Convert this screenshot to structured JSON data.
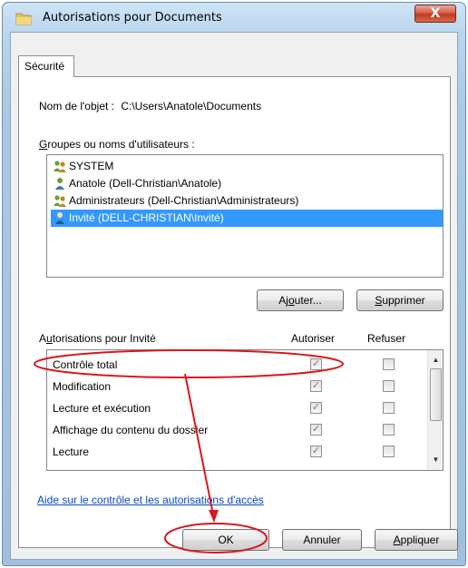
{
  "window": {
    "title": "Autorisations pour Documents",
    "close_label": "X"
  },
  "tab": {
    "label": "Sécurité"
  },
  "object": {
    "label": "Nom de l'objet :",
    "path": "C:\\Users\\Anatole\\Documents"
  },
  "groups": {
    "label_u": "G",
    "label_rest": "roupes ou noms d'utilisateurs :",
    "users": [
      {
        "name": "SYSTEM",
        "icon": "user-group-icon"
      },
      {
        "name": "Anatole (Dell-Christian\\Anatole)",
        "icon": "user-icon"
      },
      {
        "name": "Administrateurs (Dell-Christian\\Administrateurs)",
        "icon": "user-group-icon"
      },
      {
        "name": "Invité (DELL-CHRISTIAN\\Invité)",
        "icon": "user-icon",
        "selected": true
      }
    ]
  },
  "buttons": {
    "add_pre": "Aj",
    "add_u": "o",
    "add_post": "uter...",
    "remove_u": "S",
    "remove_post": "upprimer",
    "ok": "OK",
    "cancel": "Annuler",
    "apply_u": "A",
    "apply_post": "ppliquer"
  },
  "permissions": {
    "header_pre": "A",
    "header_u": "u",
    "header_post": "torisations pour Invité",
    "allow_header": "Autoriser",
    "deny_header": "Refuser",
    "rows": [
      {
        "label": "Contrôle total",
        "allow": true,
        "deny": false
      },
      {
        "label": "Modification",
        "allow": true,
        "deny": false
      },
      {
        "label": "Lecture et exécution",
        "allow": true,
        "deny": false
      },
      {
        "label": "Affichage du contenu du dossier",
        "allow": true,
        "deny": false
      },
      {
        "label": "Lecture",
        "allow": true,
        "deny": false
      }
    ]
  },
  "help_link": "Aide sur le contrôle et les autorisations d'accès",
  "colors": {
    "selection": "#3399ff",
    "annotation": "#d7191f",
    "link": "#0a47c9"
  }
}
